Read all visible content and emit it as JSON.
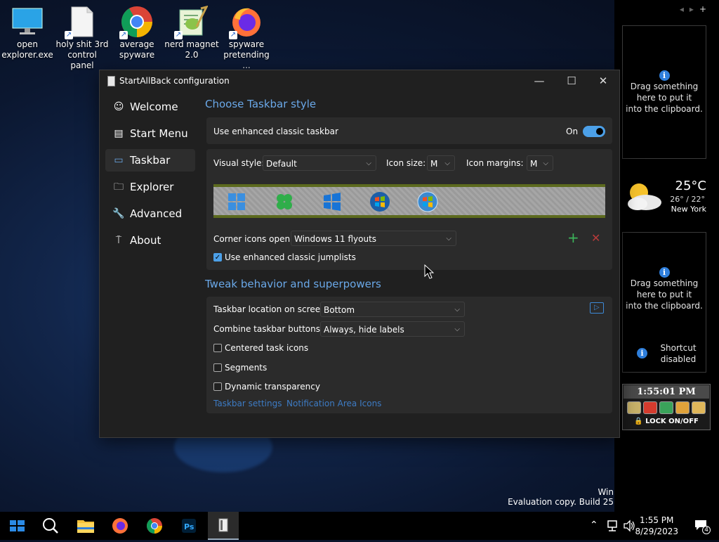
{
  "desktop": {
    "icons": [
      {
        "label": "open explorer.exe",
        "icon": "monitor-icon"
      },
      {
        "label": "holy shit 3rd control panel",
        "icon": "document-icon"
      },
      {
        "label": "average spyware",
        "icon": "chrome-icon"
      },
      {
        "label": "nerd magnet 2.0",
        "icon": "notepad-plus-plus-icon"
      },
      {
        "label": "spyware pretending ...",
        "icon": "firefox-icon"
      }
    ],
    "watermark_line1": "Win",
    "watermark_line2": "Evaluation copy. Build 25"
  },
  "sidebar_widgets": {
    "clip1": {
      "line1": "Drag something",
      "line2": "here to put it",
      "line3": "into the clipboard."
    },
    "clip2": {
      "line1": "Drag something",
      "line2": "here to put it",
      "line3": "into the clipboard.",
      "shortcut1": "Shortcut",
      "shortcut2": "disabled"
    },
    "weather": {
      "temp": "25°C",
      "range": "26° / 22°",
      "city": "New York"
    },
    "clock": {
      "time": "1:55:01 PM",
      "lock_label": "LOCK ON/OFF"
    },
    "info_glyph": "i"
  },
  "window": {
    "title": "StartAllBack configuration",
    "controls": {
      "minimize": "—",
      "maximize": "☐",
      "close": "✕"
    },
    "nav": [
      {
        "label": "Welcome",
        "icon": "smile-icon",
        "glyph": "☺"
      },
      {
        "label": "Start Menu",
        "icon": "start-menu-icon",
        "glyph": "▤"
      },
      {
        "label": "Taskbar",
        "icon": "taskbar-icon",
        "glyph": "▭"
      },
      {
        "label": "Explorer",
        "icon": "folder-icon",
        "glyph": "🗀"
      },
      {
        "label": "Advanced",
        "icon": "wrench-icon",
        "glyph": "🔧"
      },
      {
        "label": "About",
        "icon": "about-icon",
        "glyph": "⍑"
      }
    ],
    "section1_title": "Choose Taskbar style",
    "enhanced_taskbar_label": "Use enhanced classic taskbar",
    "enhanced_taskbar_state": "On",
    "visual_style_label": "Visual style:",
    "visual_style_value": "Default",
    "icon_size_label": "Icon size:",
    "icon_size_value": "M",
    "icon_margins_label": "Icon margins:",
    "icon_margins_value": "M",
    "corner_icons_label": "Corner icons open:",
    "corner_icons_value": "Windows 11 flyouts",
    "add_glyph": "+",
    "remove_glyph": "✕",
    "jumplists_label": "Use enhanced classic jumplists",
    "section2_title": "Tweak behavior and superpowers",
    "location_label": "Taskbar location on screen:",
    "location_value": "Bottom",
    "combine_label": "Combine taskbar buttons:",
    "combine_value": "Always, hide labels",
    "centered_label": "Centered task icons",
    "segments_label": "Segments",
    "dynamic_label": "Dynamic transparency",
    "taskbar_settings_link": "Taskbar settings",
    "notification_link": "Notification Area Icons",
    "chevron": "⌵",
    "check": "✓"
  },
  "taskbar": {
    "time": "1:55 PM",
    "date": "8/29/2023",
    "notification_count": "4"
  },
  "colors": {
    "accent": "#4ca0e8",
    "section_title": "#6aa8e8",
    "link": "#3d7bc4"
  }
}
